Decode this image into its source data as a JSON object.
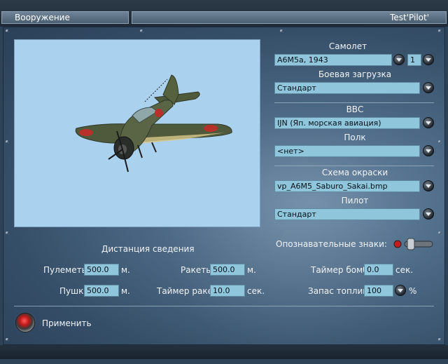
{
  "header": {
    "left_title": "Вооружение",
    "right_title": "Test'Pilot'"
  },
  "aircraft": {
    "label": "Самолет",
    "value": "A6M5a, 1943",
    "count": "1"
  },
  "loadout": {
    "label": "Боевая загрузка",
    "value": "Стандарт"
  },
  "air_force": {
    "label": "ВВС",
    "value": "IJN (Яп. морская авиация)"
  },
  "regiment": {
    "label": "Полк",
    "value": "<нет>"
  },
  "skin": {
    "label": "Схема окраски",
    "value": "vp_A6M5_Saburo_Sakai.bmp"
  },
  "pilot": {
    "label": "Пилот",
    "value": "Стандарт"
  },
  "markings": {
    "label": "Опознавательные знаки:"
  },
  "convergence": {
    "title": "Дистанция сведения",
    "machine_guns_label": "Пулеметы",
    "machine_guns_value": "500.0",
    "machine_guns_unit": "м.",
    "cannons_label": "Пушки",
    "cannons_value": "500.0",
    "cannons_unit": "м.",
    "rockets_label": "Ракеты",
    "rockets_value": "500.0",
    "rockets_unit": "м.",
    "rocket_timer_label": "Таймер ракет:",
    "rocket_timer_value": "10.0",
    "rocket_timer_unit": "сек.",
    "bomb_timer_label": "Таймер бомб:",
    "bomb_timer_value": "0.0",
    "bomb_timer_unit": "сек.",
    "fuel_label": "Запас топлива",
    "fuel_value": "100",
    "fuel_unit": "%"
  },
  "apply": {
    "label": "Применить"
  },
  "colors": {
    "field_bg": "#8fc6dc",
    "preview_bg": "#aad1ee",
    "panel_bg": "#4d6a86"
  }
}
